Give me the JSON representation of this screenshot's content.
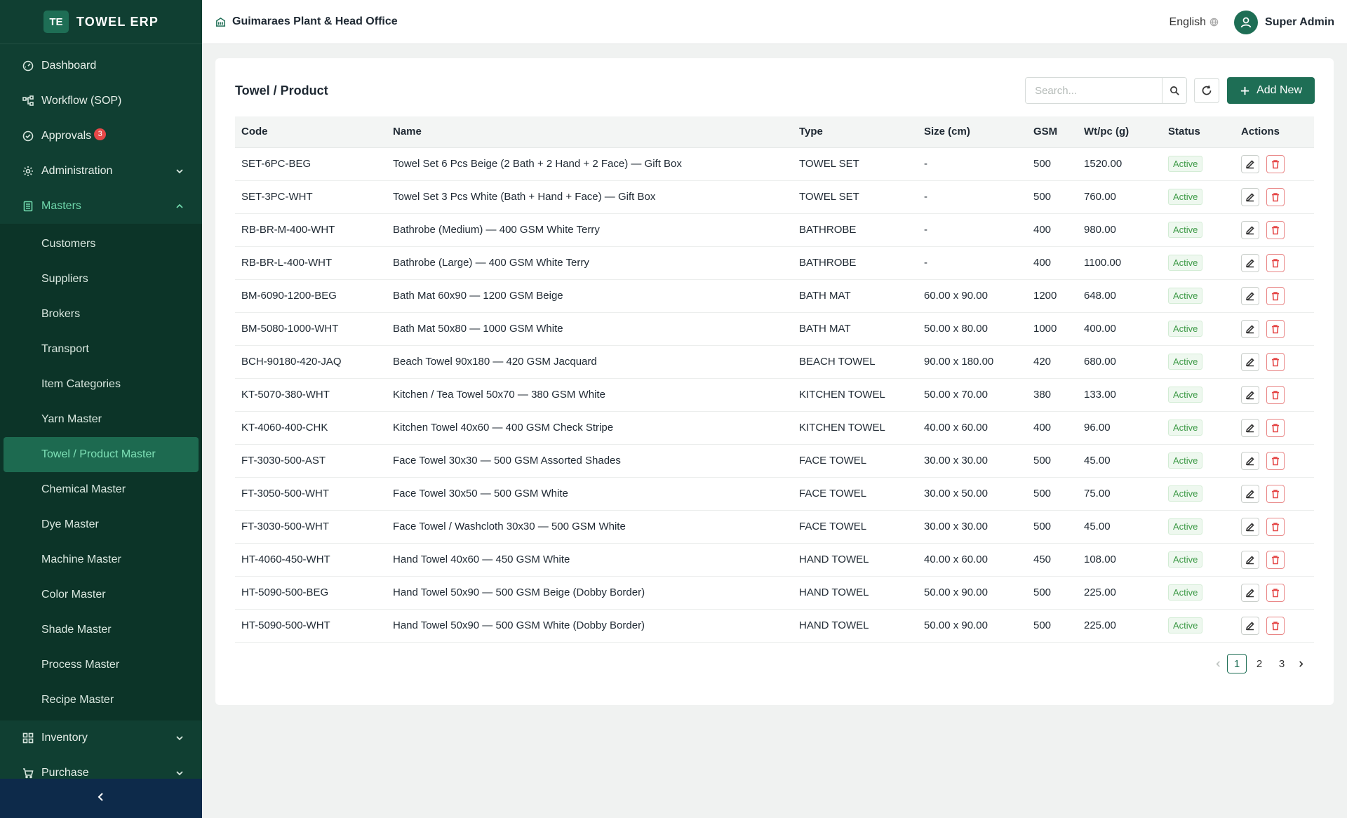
{
  "app": {
    "logo_badge": "TE",
    "logo_text": "TOWEL ERP"
  },
  "nav": {
    "dashboard": "Dashboard",
    "workflow": "Workflow (SOP)",
    "approvals": "Approvals",
    "approvals_count": "3",
    "administration": "Administration",
    "masters": "Masters",
    "inventory": "Inventory",
    "purchase": "Purchase"
  },
  "masters_items": [
    "Customers",
    "Suppliers",
    "Brokers",
    "Transport",
    "Item Categories",
    "Yarn Master",
    "Towel / Product Master",
    "Chemical Master",
    "Dye Master",
    "Machine Master",
    "Color Master",
    "Shade Master",
    "Process Master",
    "Recipe Master"
  ],
  "active_master": "Towel / Product Master",
  "header": {
    "org": "Guimaraes Plant & Head Office",
    "language": "English",
    "user": "Super Admin"
  },
  "page": {
    "title": "Towel / Product",
    "search_placeholder": "Search...",
    "add_label": "Add New"
  },
  "columns": [
    "Code",
    "Name",
    "Type",
    "Size (cm)",
    "GSM",
    "Wt/pc (g)",
    "Status",
    "Actions"
  ],
  "rows": [
    [
      "SET-6PC-BEG",
      "Towel Set 6 Pcs Beige (2 Bath + 2 Hand + 2 Face) — Gift Box",
      "TOWEL SET",
      "-",
      "500",
      "1520.00",
      "Active"
    ],
    [
      "SET-3PC-WHT",
      "Towel Set 3 Pcs White (Bath + Hand + Face) — Gift Box",
      "TOWEL SET",
      "-",
      "500",
      "760.00",
      "Active"
    ],
    [
      "RB-BR-M-400-WHT",
      "Bathrobe (Medium) — 400 GSM White Terry",
      "BATHROBE",
      "-",
      "400",
      "980.00",
      "Active"
    ],
    [
      "RB-BR-L-400-WHT",
      "Bathrobe (Large) — 400 GSM White Terry",
      "BATHROBE",
      "-",
      "400",
      "1100.00",
      "Active"
    ],
    [
      "BM-6090-1200-BEG",
      "Bath Mat 60x90 — 1200 GSM Beige",
      "BATH MAT",
      "60.00 x 90.00",
      "1200",
      "648.00",
      "Active"
    ],
    [
      "BM-5080-1000-WHT",
      "Bath Mat 50x80 — 1000 GSM White",
      "BATH MAT",
      "50.00 x 80.00",
      "1000",
      "400.00",
      "Active"
    ],
    [
      "BCH-90180-420-JAQ",
      "Beach Towel 90x180 — 420 GSM Jacquard",
      "BEACH TOWEL",
      "90.00 x 180.00",
      "420",
      "680.00",
      "Active"
    ],
    [
      "KT-5070-380-WHT",
      "Kitchen / Tea Towel 50x70 — 380 GSM White",
      "KITCHEN TOWEL",
      "50.00 x 70.00",
      "380",
      "133.00",
      "Active"
    ],
    [
      "KT-4060-400-CHK",
      "Kitchen Towel 40x60 — 400 GSM Check Stripe",
      "KITCHEN TOWEL",
      "40.00 x 60.00",
      "400",
      "96.00",
      "Active"
    ],
    [
      "FT-3030-500-AST",
      "Face Towel 30x30 — 500 GSM Assorted Shades",
      "FACE TOWEL",
      "30.00 x 30.00",
      "500",
      "45.00",
      "Active"
    ],
    [
      "FT-3050-500-WHT",
      "Face Towel 30x50 — 500 GSM White",
      "FACE TOWEL",
      "30.00 x 50.00",
      "500",
      "75.00",
      "Active"
    ],
    [
      "FT-3030-500-WHT",
      "Face Towel / Washcloth 30x30 — 500 GSM White",
      "FACE TOWEL",
      "30.00 x 30.00",
      "500",
      "45.00",
      "Active"
    ],
    [
      "HT-4060-450-WHT",
      "Hand Towel 40x60 — 450 GSM White",
      "HAND TOWEL",
      "40.00 x 60.00",
      "450",
      "108.00",
      "Active"
    ],
    [
      "HT-5090-500-BEG",
      "Hand Towel 50x90 — 500 GSM Beige (Dobby Border)",
      "HAND TOWEL",
      "50.00 x 90.00",
      "500",
      "225.00",
      "Active"
    ],
    [
      "HT-5090-500-WHT",
      "Hand Towel 50x90 — 500 GSM White (Dobby Border)",
      "HAND TOWEL",
      "50.00 x 90.00",
      "500",
      "225.00",
      "Active"
    ]
  ],
  "pagination": {
    "pages": [
      "1",
      "2",
      "3"
    ],
    "current": "1"
  },
  "colors": {
    "sidebar": "#103f32",
    "accent": "#1e6e55",
    "active_text": "#7ee0b6",
    "danger": "#e54848",
    "status_green": "#3f9b48"
  }
}
